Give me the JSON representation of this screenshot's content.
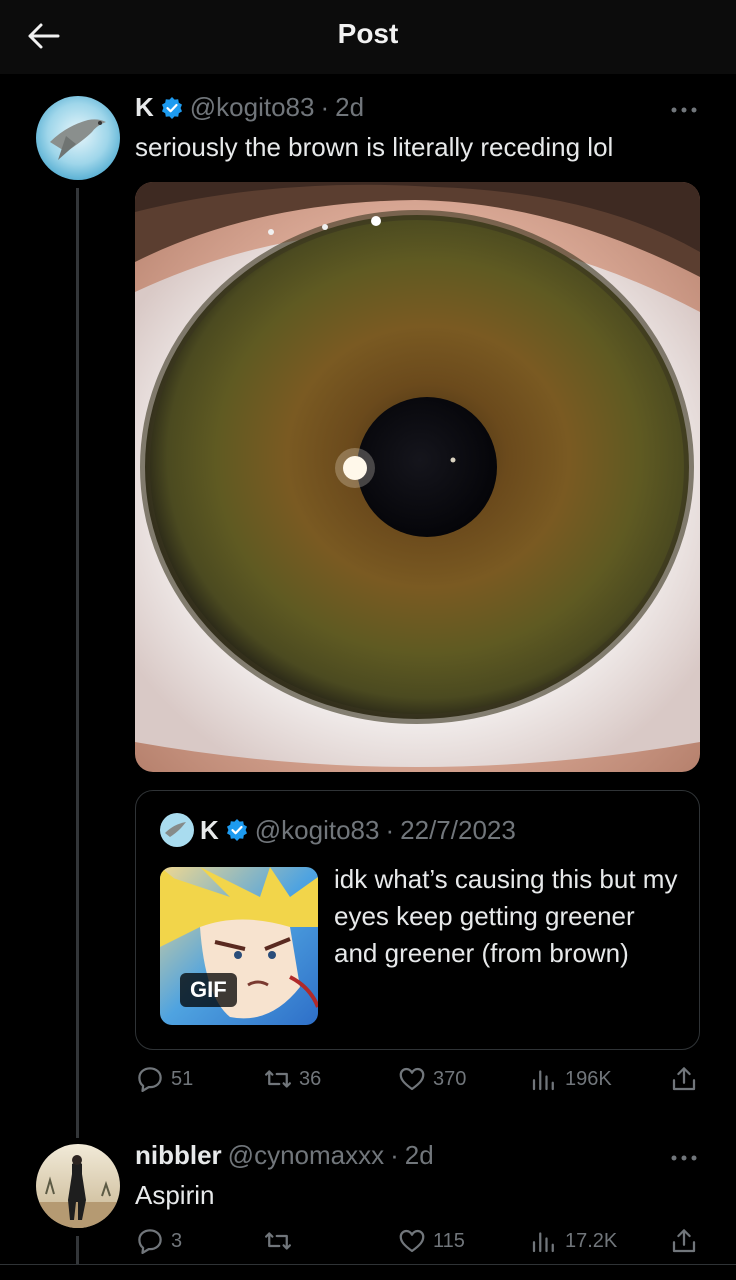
{
  "header": {
    "title": "Post"
  },
  "post": {
    "display_name": "K",
    "handle": "@kogito83",
    "separator": "·",
    "time": "2d",
    "text": "seriously the brown is literally receding lol",
    "quote": {
      "display_name": "K",
      "handle": "@kogito83",
      "separator": "·",
      "date": "22/7/2023",
      "text": "idk what’s causing this but my eyes keep getting greener and greener (from brown)",
      "gif_label": "GIF"
    },
    "stats": {
      "replies": "51",
      "reposts": "36",
      "likes": "370",
      "views": "196K"
    }
  },
  "reply": {
    "display_name": "nibbler",
    "handle": "@cynomaxxx",
    "separator": "·",
    "time": "2d",
    "text": "Aspirin",
    "stats": {
      "replies": "3",
      "reposts": "",
      "likes": "115",
      "views": "17.2K"
    }
  },
  "colors": {
    "background": "#000000",
    "muted": "#71767b",
    "verified": "#1d9bf0",
    "text": "#e7e9ea"
  },
  "icons": [
    "back-arrow-icon",
    "verified-badge-icon",
    "more-icon",
    "reply-icon",
    "repost-icon",
    "like-icon",
    "views-icon",
    "share-icon"
  ]
}
